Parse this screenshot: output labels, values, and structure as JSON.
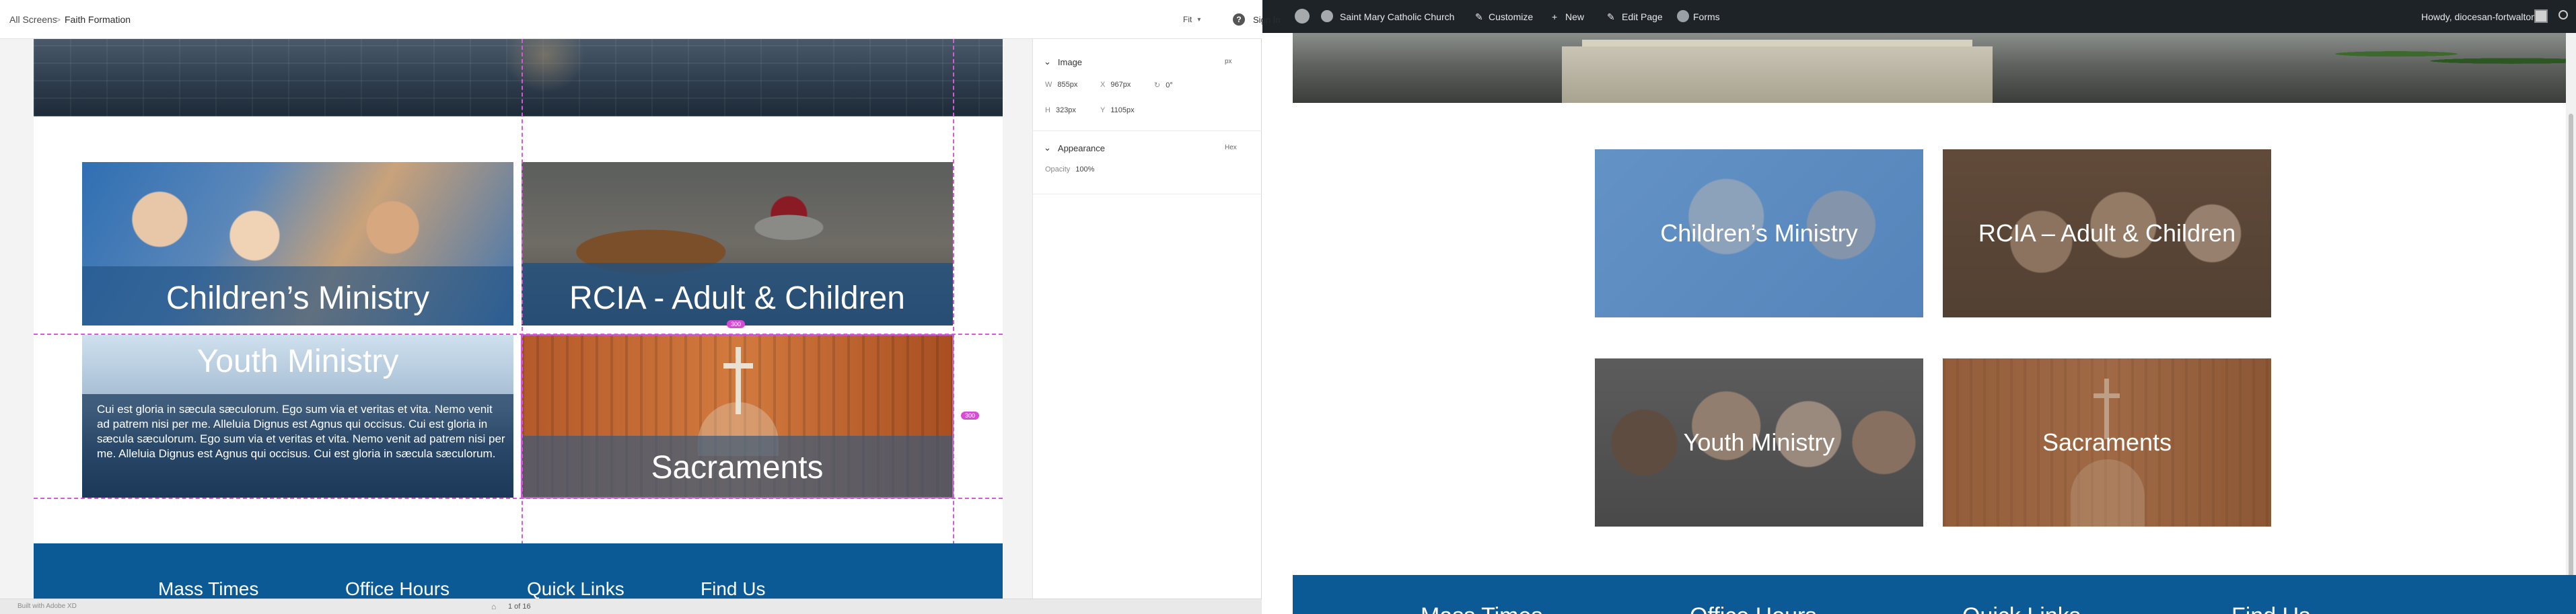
{
  "xd": {
    "breadcrumb": {
      "root": "All Screens",
      "separator": ">",
      "page": "Faith Formation"
    },
    "zoom": {
      "value": "Fit"
    },
    "help_icon": "?",
    "sign_in": "Sign In",
    "artboard": {
      "tiles": [
        {
          "label": "Children’s Ministry"
        },
        {
          "label": "RCIA - Adult & Children"
        },
        {
          "label": "Youth Ministry",
          "body": "Cui est gloria in sæcula sæculorum. Ego sum via et veritas et vita. Nemo venit ad patrem nisi per me. Alleluia Dignus est Agnus qui occisus. Cui est gloria in sæcula sæculorum. Ego sum via et veritas et vita. Nemo venit ad patrem nisi per me. Alleluia Dignus est Agnus qui occisus. Cui est gloria in sæcula sæculorum."
        },
        {
          "label": "Sacraments"
        }
      ],
      "badges": {
        "top": "300",
        "right": "300"
      },
      "footer": {
        "headings": [
          "Mass Times",
          "Office Hours",
          "Quick Links",
          "Find Us"
        ]
      }
    },
    "inspector": {
      "image": {
        "title": "Image",
        "toggle": "px",
        "w_label": "W",
        "w_value": "855px",
        "x_label": "X",
        "x_value": "967px",
        "rot_value": "0°",
        "h_label": "H",
        "h_value": "323px",
        "y_label": "Y",
        "y_value": "1105px"
      },
      "appearance": {
        "title": "Appearance",
        "toggle": "Hex",
        "opacity_label": "Opacity",
        "opacity_value": "100%"
      }
    },
    "bottom": {
      "credit": "Built with Adobe XD",
      "pager": "1 of 16"
    }
  },
  "wp": {
    "admin_bar": {
      "site_name": "Saint Mary Catholic Church",
      "customize": "Customize",
      "new": "New",
      "edit_page": "Edit Page",
      "forms": "Forms",
      "howdy": "Howdy, diocesan-fortwalton"
    },
    "tiles": [
      {
        "label": "Children’s Ministry",
        "overlay": "#3f78b8"
      },
      {
        "label": "RCIA – Adult & Children",
        "overlay": "#5a4a3e"
      },
      {
        "label": "Youth Ministry",
        "overlay": "#4a4a4a"
      },
      {
        "label": "Sacraments",
        "overlay": "#8a5a3a"
      }
    ],
    "footer": {
      "headings": [
        "Mass Times",
        "Office Hours",
        "Quick Links",
        "Find Us"
      ]
    }
  },
  "colors": {
    "footer_blue": "#0b5a95",
    "admin_bar": "#1d2327",
    "guide_magenta": "#d35bd3"
  },
  "icons": [
    "wordpress-logo-icon",
    "home-icon",
    "paint-brush-icon",
    "plus-icon",
    "pencil-icon",
    "forms-icon",
    "search-icon",
    "info-icon",
    "comment-icon",
    "chevron-down-icon"
  ]
}
